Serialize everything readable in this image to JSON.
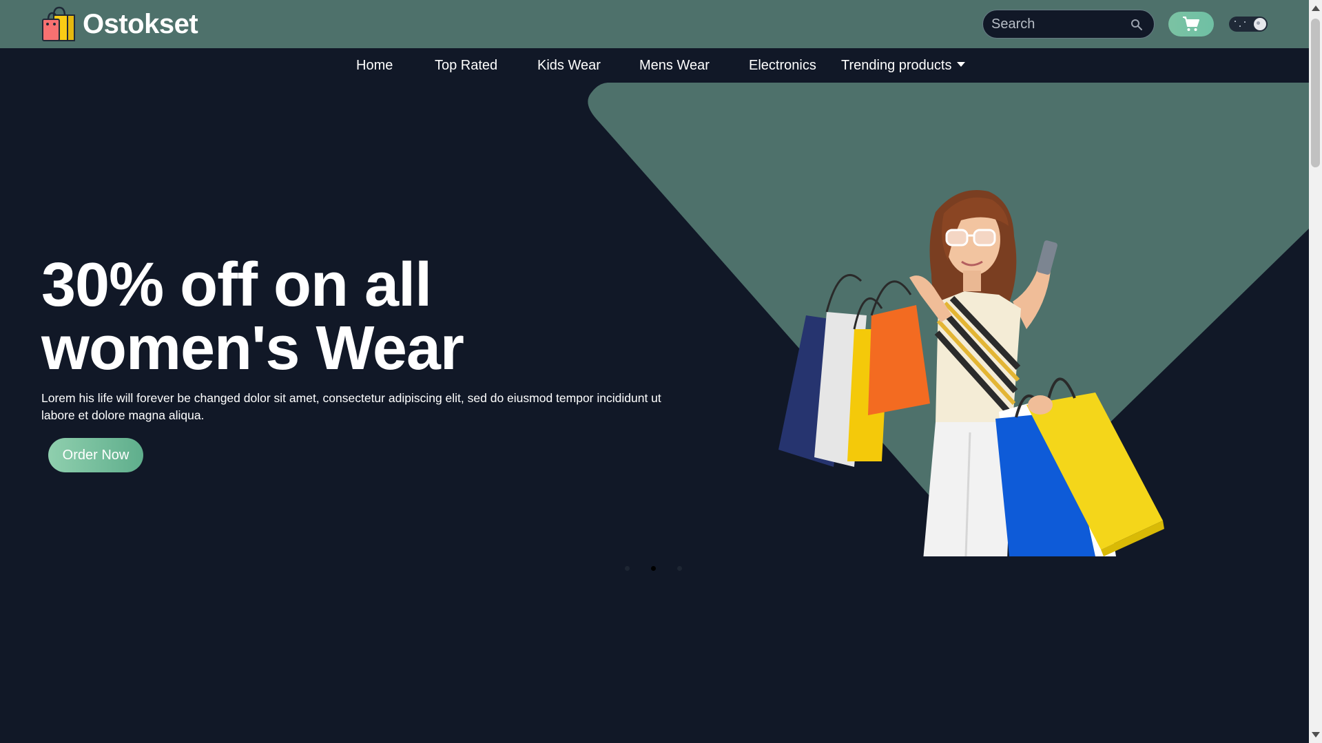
{
  "header": {
    "brand": "Ostokset",
    "search_placeholder": "Search",
    "colors": {
      "topbar": "#4e716b",
      "accent": "#74c2a6",
      "background": "#111827"
    }
  },
  "nav": {
    "items": [
      {
        "label": "Home"
      },
      {
        "label": "Top Rated"
      },
      {
        "label": "Kids Wear"
      },
      {
        "label": "Mens Wear"
      },
      {
        "label": "Electronics"
      },
      {
        "label": "Trending products",
        "has_dropdown": true
      }
    ]
  },
  "hero": {
    "title": "30% off on all women's Wear",
    "description": "Lorem his life will forever be changed dolor sit amet, consectetur adipiscing elit, sed do eiusmod tempor incididunt ut labore et dolore magna aliqua.",
    "cta_label": "Order Now",
    "carousel": {
      "slides": 3,
      "active_index": 1
    }
  },
  "icons": {
    "logo": "shopping-bags-icon",
    "search": "search-icon",
    "cart": "cart-icon",
    "theme": "dark-mode-toggle",
    "dropdown": "caret-down-icon"
  }
}
